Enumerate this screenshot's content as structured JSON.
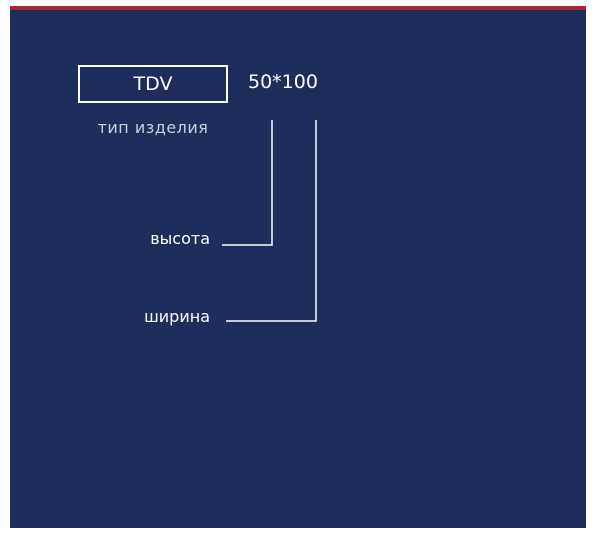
{
  "product_type": {
    "code": "TDV",
    "caption": "тип изделия"
  },
  "size": {
    "code": "50*100"
  },
  "labels": {
    "height": "высота",
    "width": "ширина"
  },
  "colors": {
    "background": "#1e2d5c",
    "accent_bar": "#a8263d",
    "text": "#ffffff"
  }
}
